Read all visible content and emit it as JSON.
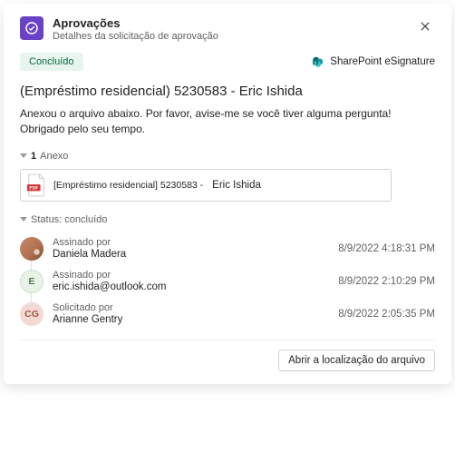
{
  "header": {
    "title": "Aprovações",
    "subtitle": "Detalhes da solicitação de aprovação"
  },
  "status_pill": "Concluído",
  "provider": "SharePoint eSignature",
  "request_title": "(Empréstimo residencial) 5230583 - Eric Ishida",
  "body": "Anexou o arquivo abaixo. Por favor, avise-me se você tiver alguma pergunta! Obrigado pelo seu tempo.",
  "attachments": {
    "header_count": "1",
    "header_label": "Anexo",
    "file_prefix": "[Empréstimo residencial] 5230583 -",
    "file_name": "Eric Ishida"
  },
  "status_section_label": "Status: concluído",
  "timeline": [
    {
      "action": "Assinado por",
      "name": "Daniela Madera",
      "time": "8/9/2022 4:18:31 PM",
      "avatar": "photo"
    },
    {
      "action": "Assinado por",
      "name": "eric.ishida@outlook.com",
      "time": "8/9/2022 2:10:29 PM",
      "avatar": "E"
    },
    {
      "action": "Solicitado por",
      "name": "Arianne Gentry",
      "time": "8/9/2022 2:05:35 PM",
      "avatar": "CG"
    }
  ],
  "footer_button": "Abrir a localização do arquivo"
}
